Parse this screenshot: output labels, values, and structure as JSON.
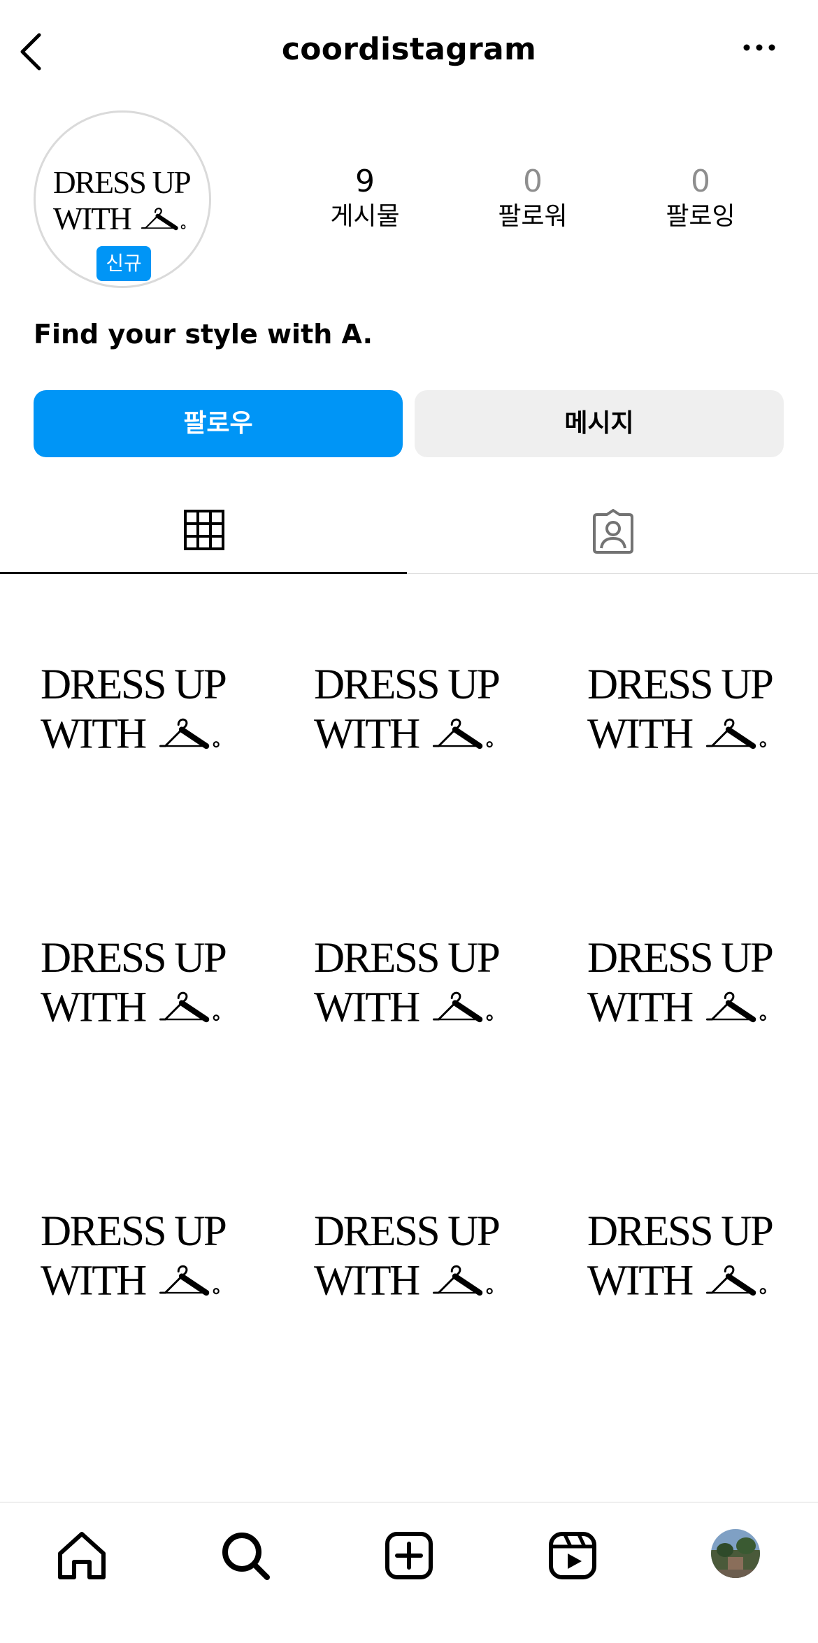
{
  "header": {
    "username": "coordistagram"
  },
  "profile": {
    "badge": "신규",
    "bio": "Find your style with A.",
    "logo_text": "DRESS UP WITH A."
  },
  "stats": {
    "posts": {
      "value": "9",
      "label": "게시물"
    },
    "followers": {
      "value": "0",
      "label": "팔로워"
    },
    "following": {
      "value": "0",
      "label": "팔로잉"
    }
  },
  "actions": {
    "follow_label": "팔로우",
    "message_label": "메시지"
  },
  "tabs": [
    {
      "icon": "grid-icon",
      "active": true
    },
    {
      "icon": "tagged-icon",
      "active": false
    }
  ],
  "posts": [
    {
      "image": "DRESS UP WITH A."
    },
    {
      "image": "DRESS UP WITH A."
    },
    {
      "image": "DRESS UP WITH A."
    },
    {
      "image": "DRESS UP WITH A."
    },
    {
      "image": "DRESS UP WITH A."
    },
    {
      "image": "DRESS UP WITH A."
    },
    {
      "image": "DRESS UP WITH A."
    },
    {
      "image": "DRESS UP WITH A."
    },
    {
      "image": "DRESS UP WITH A."
    }
  ],
  "bottom_nav": [
    "home-icon",
    "search-icon",
    "create-icon",
    "reels-icon",
    "profile-avatar"
  ],
  "colors": {
    "accent": "#0095f6",
    "secondary_button": "#efefef",
    "muted": "#8e8e8e"
  }
}
